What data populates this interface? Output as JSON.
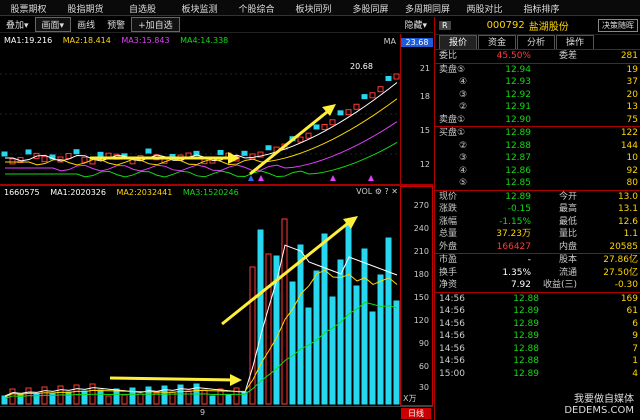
{
  "menu": [
    "股票期权",
    "股指期货",
    "自选股",
    "板块监测",
    "个股综合",
    "板块同列",
    "多股同屏",
    "多周期同屏",
    "两股对比",
    "指标排序"
  ],
  "toolbar": {
    "items": [
      "叠加▾",
      "画面▾",
      "画线",
      "预警",
      "+加自选"
    ],
    "hide_label": "隐藏▾"
  },
  "price_pane": {
    "legend": [
      {
        "label": "MA1:19.216",
        "color": "#ffffff"
      },
      {
        "label": "MA2:18.414",
        "color": "#ffd600"
      },
      {
        "label": "MA3:15.843",
        "color": "#e040fb"
      },
      {
        "label": "MA4:14.338",
        "color": "#14d814"
      }
    ],
    "ma_tag": "MA",
    "high_label": "20.68",
    "y_badge": "23.68",
    "y_ticks": [
      "21",
      "18",
      "15",
      "12"
    ]
  },
  "vol_pane": {
    "legend": [
      {
        "label": "1660575",
        "color": "#ffffff"
      },
      {
        "label": "MA1:2020326",
        "color": "#ffffff"
      },
      {
        "label": "MA2:2032441",
        "color": "#ffd600"
      },
      {
        "label": "MA3:1520246",
        "color": "#14d814"
      }
    ],
    "tool_label": "VOL",
    "y_ticks": [
      "270",
      "240",
      "210",
      "180",
      "150",
      "120",
      "90",
      "60",
      "30"
    ],
    "unit_label": "X万"
  },
  "bottom": {
    "tick": "9",
    "tab": "日线"
  },
  "quote": {
    "badge": "R",
    "code": "000792",
    "name": "盐湖股份",
    "action_button": "决策随晖",
    "tabs": [
      "报价",
      "资金",
      "分析",
      "操作"
    ],
    "weibi": {
      "label": "委比",
      "value": "45.50%",
      "label2": "委差",
      "value2": "281"
    },
    "sell": [
      {
        "label": "卖盘⑤",
        "price": "12.94",
        "vol": "19"
      },
      {
        "label": "④",
        "price": "12.93",
        "vol": "37"
      },
      {
        "label": "③",
        "price": "12.92",
        "vol": "20"
      },
      {
        "label": "②",
        "price": "12.91",
        "vol": "13"
      },
      {
        "label": "卖盘①",
        "price": "12.90",
        "vol": "75"
      }
    ],
    "buy": [
      {
        "label": "买盘①",
        "price": "12.89",
        "vol": "122"
      },
      {
        "label": "②",
        "price": "12.88",
        "vol": "144"
      },
      {
        "label": "③",
        "price": "12.87",
        "vol": "10"
      },
      {
        "label": "④",
        "price": "12.86",
        "vol": "92"
      },
      {
        "label": "⑤",
        "price": "12.85",
        "vol": "80"
      }
    ],
    "stats": [
      {
        "l1": "现价",
        "v1": "12.89",
        "l2": "今开",
        "v2": "13.0"
      },
      {
        "l1": "涨跌",
        "v1": "-0.15",
        "l2": "最高",
        "v2": "13.1"
      },
      {
        "l1": "涨幅",
        "v1": "-1.15%",
        "l2": "最低",
        "v2": "12.6"
      },
      {
        "l1": "总量",
        "v1": "37.23万",
        "l2": "量比",
        "v2": "1.1"
      },
      {
        "l1": "外盘",
        "v1": "166427",
        "l2": "内盘",
        "v2": "20585"
      }
    ],
    "fin": [
      {
        "l1": "市盈",
        "v1": "-",
        "l2": "股本",
        "v2": "27.86亿"
      },
      {
        "l1": "换手",
        "v1": "1.35%",
        "l2": "流通",
        "v2": "27.50亿"
      },
      {
        "l1": "净资",
        "v1": "7.92",
        "l2": "收益(三)",
        "v2": "-0.30"
      }
    ],
    "ticks": [
      {
        "time": "14:56",
        "price": "12.88",
        "vol": "169"
      },
      {
        "time": "14:56",
        "price": "12.89",
        "vol": "61"
      },
      {
        "time": "14:56",
        "price": "12.89",
        "vol": "6"
      },
      {
        "time": "14:56",
        "price": "12.89",
        "vol": "9"
      },
      {
        "time": "14:56",
        "price": "12.88",
        "vol": "7"
      },
      {
        "time": "14:56",
        "price": "12.88",
        "vol": "1"
      },
      {
        "time": "15:00",
        "price": "12.89",
        "vol": "4"
      }
    ]
  },
  "watermark": [
    "我要做自媒体",
    "DEDEMS.COM"
  ]
}
